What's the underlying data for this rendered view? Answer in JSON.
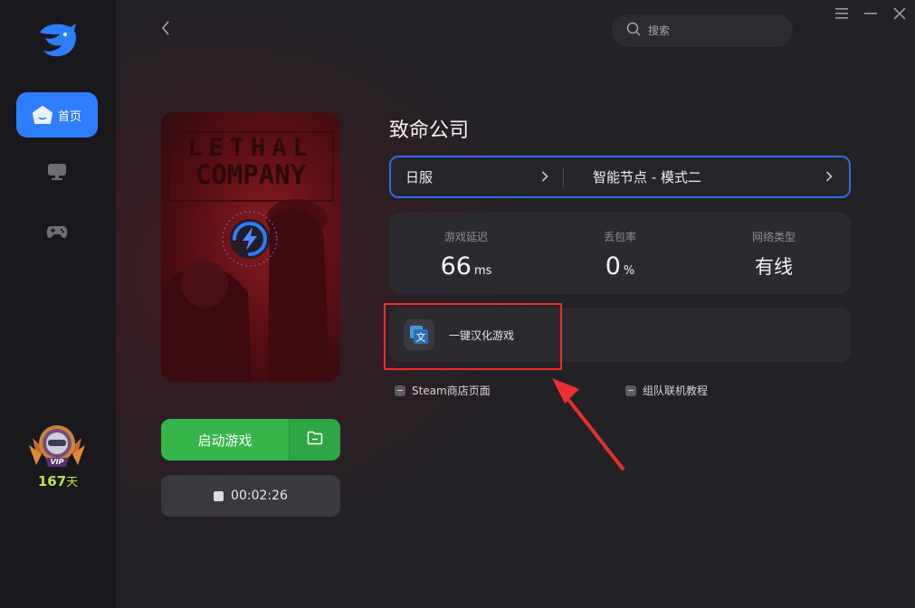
{
  "sidebar": {
    "home_label": "首页",
    "vip_badge": "VIP",
    "vip_days": "167",
    "vip_days_unit": "天"
  },
  "header": {
    "search_placeholder": "搜索"
  },
  "game": {
    "title": "致命公司",
    "cover_line1": "LETHAL",
    "cover_line2": "COMPANY",
    "start_label": "启动游戏",
    "timer": "00:02:26"
  },
  "route": {
    "region": "日服",
    "node": "智能节点 - 模式二"
  },
  "stats": {
    "latency_label": "游戏延迟",
    "latency_value": "66",
    "latency_unit": "ms",
    "loss_label": "丢包率",
    "loss_value": "0",
    "loss_unit": "%",
    "net_label": "网络类型",
    "net_value": "有线"
  },
  "tools": {
    "translate_label": "一键汉化游戏",
    "translate_icon_char": "文"
  },
  "links": {
    "steam": "Steam商店页面",
    "team": "组队联机教程"
  },
  "colors": {
    "accent_blue": "#2f7dff",
    "start_green": "#35b54a",
    "highlight_red": "#e8302f",
    "vip_green": "#b7e84a"
  }
}
